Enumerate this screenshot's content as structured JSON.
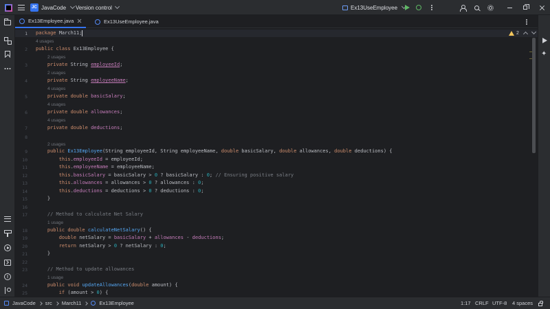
{
  "titlebar": {
    "project_badge": "JC",
    "project_name": "JavaCode",
    "vcs_label": "Version control",
    "run_config": "Ex13UseEmployee"
  },
  "tabs": [
    {
      "label": "Ex13Employee.java",
      "active": true
    },
    {
      "label": "Ex13UseEmployee.java",
      "active": false
    }
  ],
  "editor": {
    "inspection_count": "2",
    "current_line": 1,
    "line_numbers": [
      "1",
      "2",
      "3",
      "4",
      "5",
      "6",
      "7",
      "8",
      "9",
      "10",
      "11",
      "12",
      "13",
      "14",
      "15",
      "16",
      "17",
      "18",
      "19",
      "20",
      "21",
      "22",
      "23",
      "24",
      "25"
    ],
    "usage_hints": [
      "4 usages",
      "2 usages",
      "2 usages",
      "4 usages",
      "4 usages",
      "4 usages",
      "2 usages",
      "1 usage",
      "1 usage"
    ],
    "lines": [
      "package March11;",
      "public class Ex13Employee {",
      "private String employeeId;",
      "private String employeeName;",
      "private double basicSalary;",
      "private double allowances;",
      "private double deductions;",
      "",
      "public Ex13Employee(String employeeId, String employeeName, double basicSalary, double allowances, double deductions) {",
      "this.employeeId = employeeId;",
      "this.employeeName = employeeName;",
      "this.basicSalary = basicSalary > 0 ? basicSalary : 0; // Ensuring positive salary",
      "this.allowances = allowances > 0 ? allowances : 0;",
      "this.deductions = deductions > 0 ? deductions : 0;",
      "}",
      "",
      "// Method to calculate Net Salary",
      "public double calculateNetSalary() {",
      "double netSalary = basicSalary + allowances - deductions;",
      "return netSalary > 0 ? netSalary : 0;",
      "}",
      "",
      "// Method to update allowances",
      "public void updateAllowances(double amount) {",
      "if (amount > 0) {"
    ]
  },
  "statusbar": {
    "breadcrumb": [
      "JavaCode",
      "src",
      "March11",
      "Ex13Employee"
    ],
    "position": "1:17",
    "line_separator": "CRLF",
    "encoding": "UTF-8",
    "indent": "4 spaces"
  },
  "colors": {
    "accent": "#3574f0",
    "keyword": "#cf8e6d",
    "field": "#c77dbb",
    "method": "#56a8f5",
    "number": "#2aacb8",
    "comment": "#7a7e85",
    "run_green": "#5fb865",
    "warning": "#f2c55c"
  },
  "icons": {
    "titlebar": [
      "app-logo-icon",
      "hamburger-menu-icon",
      "run-config-icon",
      "run-icon",
      "debug-icon",
      "more-vertical-icon",
      "add-user-icon",
      "search-icon",
      "settings-gear-icon",
      "minimize-icon",
      "restore-icon",
      "close-icon"
    ],
    "left_strip": [
      "project-folder-icon",
      "structure-icon",
      "bookmarks-icon",
      "more-horizontal-icon",
      "todo-list-icon",
      "build-hammer-icon",
      "run-tool-icon",
      "terminal-icon",
      "problems-icon",
      "git-icon"
    ],
    "right_strip": [
      "notifications-run-icon",
      "ai-assistant-sparkle-icon"
    ]
  }
}
